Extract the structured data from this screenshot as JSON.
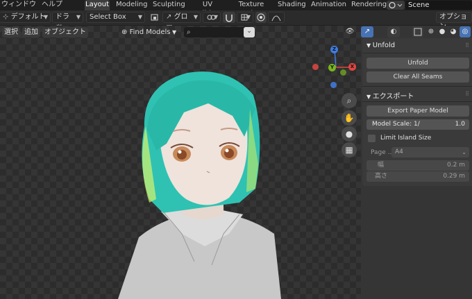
{
  "menu": {
    "window": "ウィンドウ",
    "help": "ヘルプ"
  },
  "workspaces": [
    "Layout",
    "Modeling",
    "Sculpting",
    "UV Editing",
    "Texture Paint",
    "Shading",
    "Animation",
    "Rendering"
  ],
  "scene": {
    "name": "Scene"
  },
  "toolbar": {
    "orientation": "デフォルト",
    "drag": "ドラッ...",
    "select_box": "Select Box",
    "transform": "グロー...",
    "options": "オプション"
  },
  "viewport_header": {
    "select": "選択",
    "add": "追加",
    "object": "オブジェクト",
    "find_models": "Find Models",
    "search_value": ""
  },
  "gizmo": {
    "z": "Z",
    "y": "Y",
    "x": "X"
  },
  "unfold_panel": {
    "title": "Unfold",
    "unfold_button": "Unfold",
    "clear_seams_button": "Clear All Seams"
  },
  "export_panel": {
    "title": "エクスポート",
    "export_button": "Export Paper Model",
    "model_scale_label": "Model Scale: 1/",
    "model_scale_value": "1.0",
    "limit_island_label": "Limit Island Size",
    "page_label": "Page ...",
    "page_value": "A4",
    "width_label": "幅",
    "width_value": "0.2 m",
    "height_label": "高さ",
    "height_value": "0.29 m"
  },
  "colors": {
    "accent": "#4772b3",
    "hair": "#2ec4b6",
    "axis_x": "#e0463f",
    "axis_y": "#7ab51d",
    "axis_z": "#3f7be0"
  }
}
